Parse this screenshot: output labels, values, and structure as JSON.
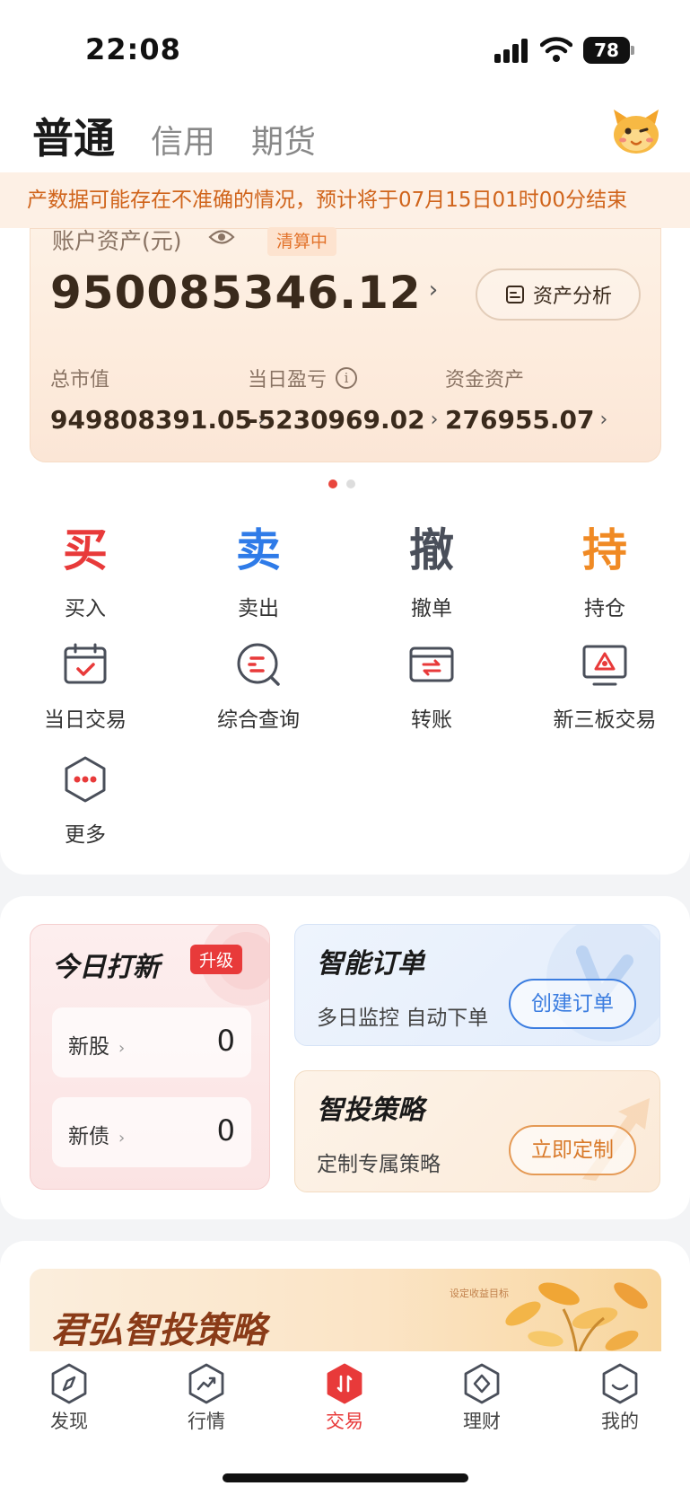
{
  "status_bar": {
    "time": "22:08",
    "battery": "78"
  },
  "tabs": [
    {
      "label": "普通",
      "active": true
    },
    {
      "label": "信用",
      "active": false
    },
    {
      "label": "期货",
      "active": false
    }
  ],
  "notice": {
    "text": "产数据可能存在不准确的情况，预计将于07月15日01时00分结束"
  },
  "asset": {
    "label": "账户资产(元)",
    "badge": "清算中",
    "total": "950085346.12",
    "analysis_label": "资产分析",
    "market_value": {
      "label": "总市值",
      "value": "949808391.05"
    },
    "daily_pnl": {
      "label": "当日盈亏",
      "value": "-5230969.02"
    },
    "cash": {
      "label": "资金资产",
      "value": "276955.07"
    }
  },
  "pager": {
    "count": 2,
    "active": 0
  },
  "actions": {
    "buy": {
      "glyph": "买",
      "label": "买入"
    },
    "sell": {
      "glyph": "卖",
      "label": "卖出"
    },
    "cancel": {
      "glyph": "撤",
      "label": "撤单"
    },
    "hold": {
      "glyph": "持",
      "label": "持仓"
    },
    "daily_trade": {
      "label": "当日交易"
    },
    "query": {
      "label": "综合查询"
    },
    "transfer": {
      "label": "转账"
    },
    "neeq": {
      "label": "新三板交易"
    },
    "more": {
      "label": "更多"
    }
  },
  "ipo": {
    "title": "今日打新",
    "badge": "升级",
    "rows": [
      {
        "label": "新股",
        "value": "0"
      },
      {
        "label": "新债",
        "value": "0"
      }
    ]
  },
  "smart_order": {
    "title": "智能订单",
    "subtitle": "多日监控 自动下单",
    "button": "创建订单"
  },
  "strategy": {
    "title": "智投策略",
    "subtitle": "定制专属策略",
    "button": "立即定制"
  },
  "banner": {
    "title": "君弘智投策略",
    "note": "设定收益目标"
  },
  "bottom_nav": [
    {
      "label": "发现",
      "icon": "compass-icon"
    },
    {
      "label": "行情",
      "icon": "trend-icon"
    },
    {
      "label": "交易",
      "icon": "trade-icon",
      "active": true
    },
    {
      "label": "理财",
      "icon": "wealth-icon"
    },
    {
      "label": "我的",
      "icon": "profile-icon"
    }
  ],
  "colors": {
    "buy": "#e83a3a",
    "sell": "#2f7be8",
    "cancel": "#4a4f5a",
    "hold": "#f08a24",
    "accent": "#e83a3a"
  }
}
